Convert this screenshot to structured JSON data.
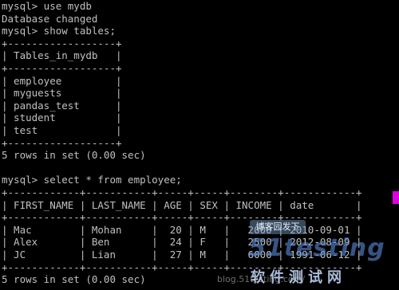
{
  "terminal": {
    "text_color": "#c0c0c0",
    "background": "#000000",
    "lines": [
      "mysql> use mydb",
      "Database changed",
      "mysql> show tables;",
      "+------------------+",
      "| Tables_in_mydb   |",
      "+------------------+",
      "| employee         |",
      "| myguests         |",
      "| pandas_test      |",
      "| student          |",
      "| test             |",
      "+------------------+",
      "5 rows in set (0.00 sec)",
      "",
      "mysql> select * from employee;",
      "+------------+-----------+-----+-----+--------+------------+",
      "| FIRST_NAME | LAST_NAME | AGE | SEX | INCOME | date       |",
      "+------------+-----------+-----+-----+--------+------------+",
      "| Mac        | Mohan     |  20 | M   |   2000 | 2010-09-01 |",
      "| Alex       | Ben       |  24 | F   |   2500 | 2012-08-09 |",
      "| JC         | Lian      |  27 | M   |   6000 | 1991-06-12 |",
      "+------------+-----------+-----+-----+--------+------------+",
      "5 rows in set (0.00 sec)"
    ]
  },
  "scrollbar": {
    "thumb_color": "#e000e0"
  },
  "watermarks": {
    "badge": "博客园发下",
    "site_logo": "51testing",
    "site_name": "软件测试网",
    "blog_url": "blog.51testing.com/"
  }
}
